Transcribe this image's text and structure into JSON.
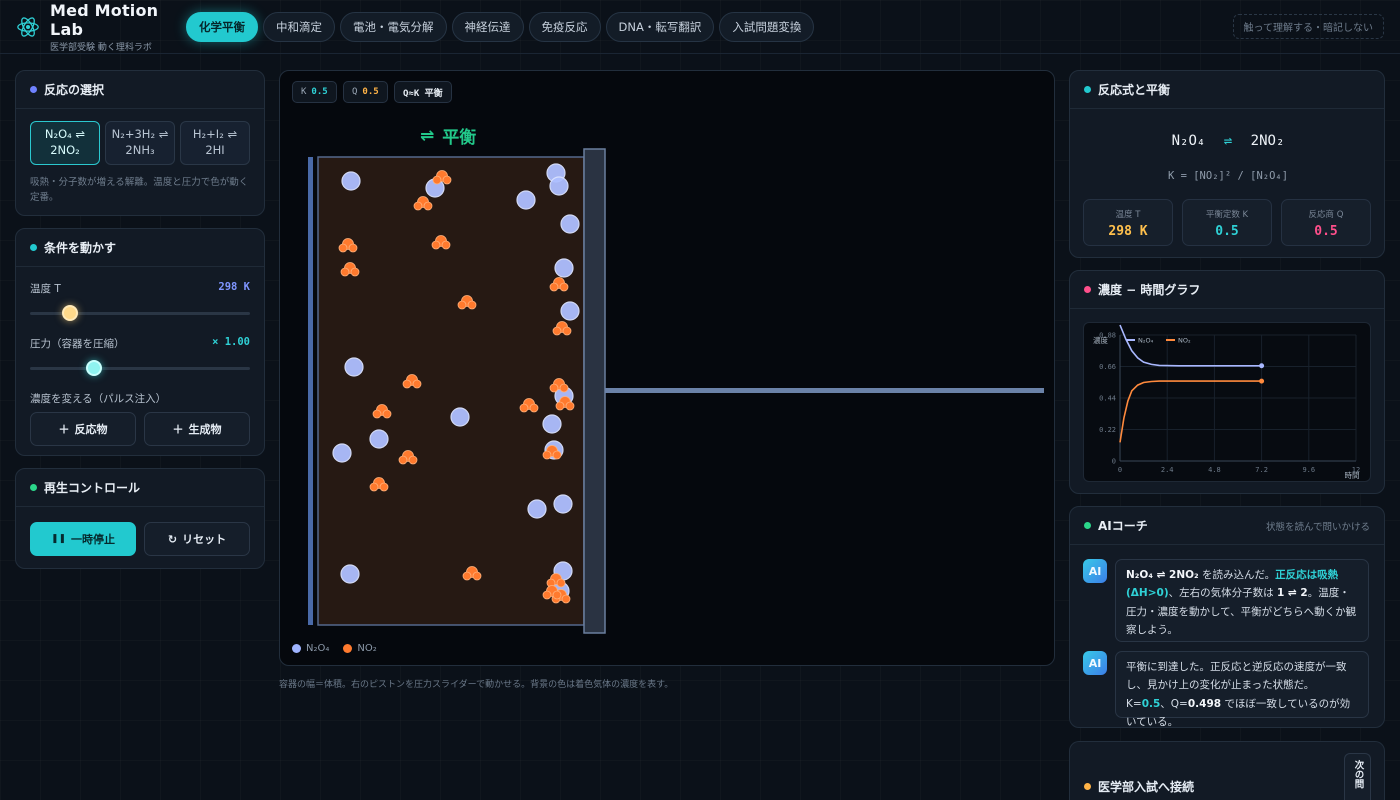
{
  "app": {
    "title": "Med Motion Lab",
    "subtitle": "医学部受験 動く理科ラボ",
    "tagline": "触って理解する・暗記しない"
  },
  "nav": {
    "tabs": [
      {
        "label": "化学平衡",
        "active": true
      },
      {
        "label": "中和滴定",
        "active": false
      },
      {
        "label": "電池・電気分解",
        "active": false
      },
      {
        "label": "神経伝達",
        "active": false
      },
      {
        "label": "免疫反応",
        "active": false
      },
      {
        "label": "DNA・転写翻訳",
        "active": false
      },
      {
        "label": "入試問題変換",
        "active": false
      }
    ]
  },
  "reaction_select": {
    "title": "反応の選択",
    "options": [
      {
        "line1": "N₂O₄ ⇌",
        "line2": "2NO₂",
        "active": true
      },
      {
        "line1": "N₂+3H₂ ⇌",
        "line2": "2NH₃",
        "active": false
      },
      {
        "line1": "H₂+I₂ ⇌",
        "line2": "2HI",
        "active": false
      }
    ],
    "note": "吸熱・分子数が増える解離。温度と圧力で色が動く定番。"
  },
  "conditions": {
    "title": "条件を動かす",
    "temperature_label": "温度 T",
    "temperature_value": "298 K",
    "temperature_fraction": 0.18,
    "pressure_label": "圧力（容器を圧縮）",
    "pressure_value": "× 1.00",
    "pressure_fraction": 0.29,
    "concentration_label": "濃度を変える（パルス注入）",
    "add_reactant": "反応物",
    "add_product": "生成物"
  },
  "playback": {
    "title": "再生コントロール",
    "pause": "一時停止",
    "reset": "リセット"
  },
  "simulation": {
    "k_label": "K",
    "k_value": "0.5",
    "q_label": "Q",
    "q_value": "0.5",
    "state_badge": "Q≈K 平衡",
    "status_text": "平衡",
    "legend_reactant": "N₂O₄",
    "legend_product": "NO₂",
    "caption": "容器の幅＝体積。右のピストンを圧力スライダーで動かせる。背景の色は着色気体の濃度を表す。",
    "colors": {
      "reactant": "#9fb4ff",
      "product": "#ff7a2e",
      "accent": "#22c9cf"
    }
  },
  "equation_panel": {
    "title": "反応式と平衡",
    "left": "N₂O₄",
    "arrow": "⇌",
    "right": "2NO₂",
    "k_expression": "K = [NO₂]² / [N₂O₄]",
    "temp_label": "温度 T",
    "temp_value": "298 K",
    "k_label": "平衡定数 K",
    "k_value": "0.5",
    "q_label": "反応商 Q",
    "q_value": "0.5"
  },
  "graph_panel": {
    "title": "濃度 − 時間グラフ"
  },
  "chart_data": {
    "type": "line",
    "title": "",
    "xlabel": "時間",
    "ylabel": "濃度",
    "xlim": [
      0,
      12
    ],
    "ylim": [
      0,
      0.88
    ],
    "x_ticks": [
      "0",
      "2.4",
      "4.8",
      "7.2",
      "9.6",
      "12"
    ],
    "y_ticks": [
      "0",
      "0.22",
      "0.44",
      "0.66",
      "0.88"
    ],
    "legend": "top-left",
    "grid": true,
    "series": [
      {
        "name": "N₂O₄",
        "color": "#a9b8ff",
        "x": [
          0,
          0.3,
          0.6,
          0.9,
          1.2,
          1.6,
          2.0,
          3.0,
          4.0,
          5.5,
          7.2
        ],
        "y": [
          0.95,
          0.85,
          0.77,
          0.72,
          0.69,
          0.675,
          0.668,
          0.665,
          0.665,
          0.665,
          0.665
        ]
      },
      {
        "name": "NO₂",
        "color": "#ff8a3d",
        "x": [
          0,
          0.2,
          0.4,
          0.6,
          0.9,
          1.2,
          1.6,
          2.0,
          3.0,
          4.0,
          5.5,
          7.2
        ],
        "y": [
          0.13,
          0.3,
          0.42,
          0.49,
          0.53,
          0.548,
          0.555,
          0.558,
          0.558,
          0.558,
          0.558,
          0.558
        ]
      }
    ]
  },
  "coach": {
    "title": "AIコーチ",
    "subtitle": "状態を読んで問いかける",
    "avatar": "AI",
    "msg1_a": "N₂O₄ ⇌ 2NO₂",
    "msg1_b": " を読み込んだ。",
    "msg1_hl": "正反応は吸熱(ΔH>0)",
    "msg1_c": "、左右の気体分子数は ",
    "msg1_d": "1 ⇌ 2",
    "msg1_e": "。温度・圧力・濃度を動かして、平衡がどちらへ動くか観察しよう。",
    "msg2_a": "平衡に到達した。正反応と逆反応の速度が一致し、見かけ上の変化が止まった状態だ。K=",
    "msg2_k": "0.5",
    "msg2_b": "、Q=",
    "msg2_q": "0.498",
    "msg2_c": " でほぼ一致しているのが効いている。"
  },
  "exam_panel": {
    "title": "医学部入試へ接続",
    "next_button": "次の問"
  }
}
